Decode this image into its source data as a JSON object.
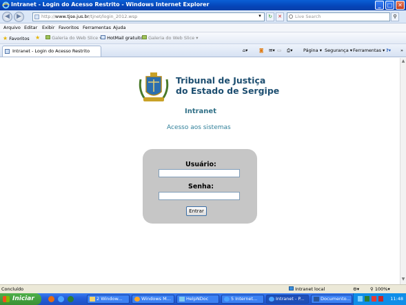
{
  "window": {
    "title": "Intranet - Login do Acesso Restrito - Windows Internet Explorer",
    "minimize": "_",
    "maximize": "□",
    "close": "✕"
  },
  "address_bar": {
    "url_prefix": "http://",
    "url_host": "www.tjse.jus.br",
    "url_path": "/tjnet/login_2012.wsp",
    "search_placeholder": "Live Search"
  },
  "menu": [
    "Arquivo",
    "Editar",
    "Exibir",
    "Favoritos",
    "Ferramentas",
    "Ajuda"
  ],
  "favorites_bar": {
    "favorites_label": "Favoritos",
    "items": [
      "Galeria do Web Slice ▾",
      "HotMail gratuito",
      "Galeria do Web Slice ▾"
    ]
  },
  "tab": {
    "label": "Intranet - Login do Acesso Restrito"
  },
  "command_bar": {
    "page": "Página ▾",
    "security": "Segurança ▾",
    "tools": "Ferramentas ▾",
    "help": "?"
  },
  "page": {
    "court_line1": "Tribunal de Justiça",
    "court_line2": "do Estado de Sergipe",
    "heading": "Intranet",
    "subheading": "Acesso aos sistemas",
    "username_label": "Usuário:",
    "username_value": "",
    "password_label": "Senha:",
    "password_value": "",
    "submit_label": "Entrar"
  },
  "status_bar": {
    "status": "Concluído",
    "zone": "Intranet local",
    "zoom": "100%"
  },
  "taskbar": {
    "start": "Iniciar",
    "tasks": [
      "2 Window...",
      "Windows M...",
      "HelpNDoc",
      "5 Internet...",
      "Intranet - P...",
      "Documento..."
    ],
    "clock": "11:48"
  },
  "colors": {
    "court_text": "#1d4e70",
    "heading_text": "#2f6f86",
    "login_box": "#c6c6c6",
    "titlebar": "#0545b8"
  }
}
